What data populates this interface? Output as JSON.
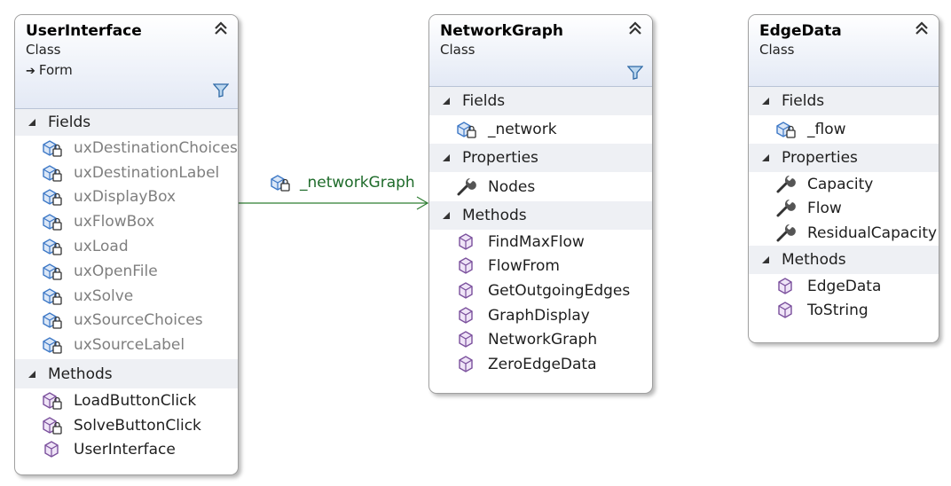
{
  "diagram": {
    "classes": {
      "user_interface": {
        "name": "UserInterface",
        "stereotype": "Class",
        "base": "Form",
        "sections": {
          "fields": {
            "label": "Fields",
            "items": [
              "uxDestinationChoices",
              "uxDestinationLabel",
              "uxDisplayBox",
              "uxFlowBox",
              "uxLoad",
              "uxOpenFile",
              "uxSolve",
              "uxSourceChoices",
              "uxSourceLabel"
            ]
          },
          "methods": {
            "label": "Methods",
            "items": [
              "LoadButtonClick",
              "SolveButtonClick",
              "UserInterface"
            ]
          }
        }
      },
      "network_graph": {
        "name": "NetworkGraph",
        "stereotype": "Class",
        "sections": {
          "fields": {
            "label": "Fields",
            "items": [
              "_network"
            ]
          },
          "properties": {
            "label": "Properties",
            "items": [
              "Nodes"
            ]
          },
          "methods": {
            "label": "Methods",
            "items": [
              "FindMaxFlow",
              "FlowFrom",
              "GetOutgoingEdges",
              "GraphDisplay",
              "NetworkGraph",
              "ZeroEdgeData"
            ]
          }
        }
      },
      "edge_data": {
        "name": "EdgeData",
        "stereotype": "Class",
        "sections": {
          "fields": {
            "label": "Fields",
            "items": [
              "_flow"
            ]
          },
          "properties": {
            "label": "Properties",
            "items": [
              "Capacity",
              "Flow",
              "ResidualCapacity"
            ]
          },
          "methods": {
            "label": "Methods",
            "items": [
              "EdgeData",
              "ToString"
            ]
          }
        }
      }
    },
    "association": {
      "label": "_networkGraph",
      "from": "UserInterface",
      "to": "NetworkGraph"
    },
    "icons": {
      "collapse": "double-chevron-up-icon",
      "filter": "filter-icon",
      "inherit": "inheritance-arrow-icon",
      "field": "private-field-icon",
      "property": "wrench-property-icon",
      "method": "method-cube-icon",
      "private_method": "private-method-icon",
      "section": "expanded-triangle-icon"
    },
    "colors": {
      "header_gradient_end": "#e3e9f5",
      "section_band": "#eef0f4",
      "association_line": "#2e7d32",
      "field_icon": "#3d78c6",
      "method_icon": "#7a4f9c"
    }
  }
}
